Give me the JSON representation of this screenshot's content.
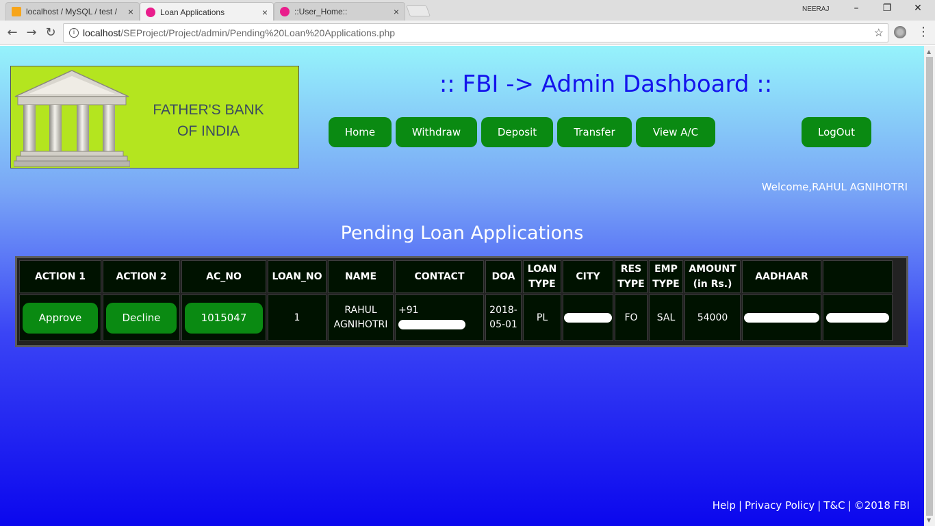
{
  "browser": {
    "tabs": [
      {
        "title": "localhost / MySQL / test /",
        "favicon_color": "#f7a51a"
      },
      {
        "title": "Loan Applications",
        "favicon_color": "#e91e8c"
      },
      {
        "title": "::User_Home::",
        "favicon_color": "#e91e8c"
      }
    ],
    "window_user": "NEERAJ",
    "url_host": "localhost",
    "url_path": "/SEProject/Project/admin/Pending%20Loan%20Applications.php"
  },
  "header": {
    "bank_name_line1": "FATHER'S BANK",
    "bank_name_line2": "OF INDIA",
    "title": ":: FBI -> Admin Dashboard ::",
    "nav": [
      {
        "label": "Home"
      },
      {
        "label": "Withdraw"
      },
      {
        "label": "Deposit"
      },
      {
        "label": "Transfer"
      },
      {
        "label": "View A/C"
      }
    ],
    "logout_label": "LogOut",
    "welcome": "Welcome,RAHUL AGNIHOTRI"
  },
  "main": {
    "section_title": "Pending Loan Applications",
    "columns": [
      {
        "line1": "ACTION 1",
        "line2": ""
      },
      {
        "line1": "ACTION 2",
        "line2": ""
      },
      {
        "line1": "AC_NO",
        "line2": ""
      },
      {
        "line1": "LOAN_NO",
        "line2": ""
      },
      {
        "line1": "NAME",
        "line2": ""
      },
      {
        "line1": "CONTACT",
        "line2": ""
      },
      {
        "line1": "DOA",
        "line2": ""
      },
      {
        "line1": "LOAN",
        "line2": "TYPE"
      },
      {
        "line1": "CITY",
        "line2": ""
      },
      {
        "line1": "RES",
        "line2": "TYPE"
      },
      {
        "line1": "EMP",
        "line2": "TYPE"
      },
      {
        "line1": "AMOUNT",
        "line2": "(in Rs.)"
      },
      {
        "line1": "AADHAAR",
        "line2": ""
      },
      {
        "line1": "",
        "line2": ""
      }
    ],
    "row": {
      "approve_label": "Approve",
      "decline_label": "Decline",
      "ac_no": "1015047",
      "loan_no": "1",
      "name_line1": "RAHUL",
      "name_line2": "AGNIHOTRI",
      "contact_prefix": "+91",
      "doa_line1": "2018-",
      "doa_line2": "05-01",
      "loan_type": "PL",
      "res_type": "FO",
      "emp_type": "SAL",
      "amount": "54000"
    }
  },
  "footer": {
    "help": "Help",
    "privacy": "Privacy Policy",
    "tnc": "T&C",
    "copyright": "©2018 FBI",
    "separator": "|"
  },
  "colors": {
    "button_green": "#0a8a12",
    "title_blue": "#1414ec",
    "logo_bg": "#b4e51f",
    "table_cell_bg": "#001200"
  }
}
